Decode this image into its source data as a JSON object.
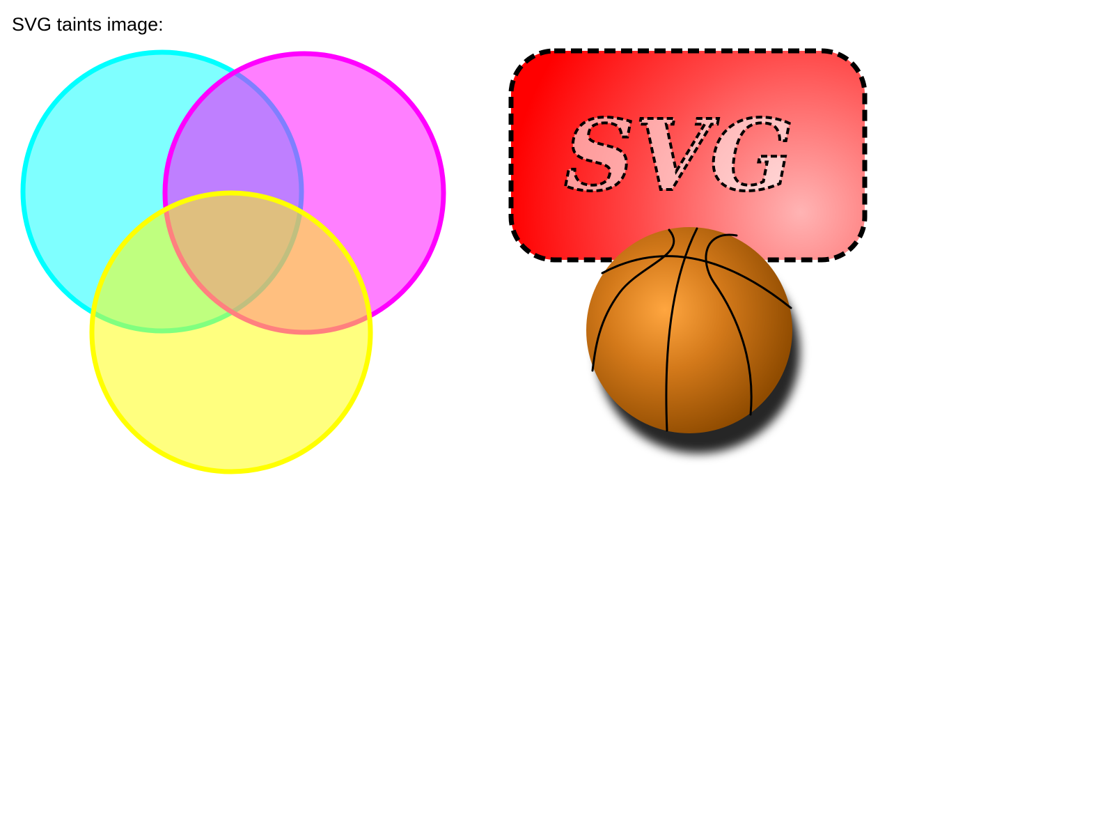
{
  "caption": "SVG taints image:",
  "venn": {
    "circles": [
      {
        "name": "cyan-circle",
        "stroke": "#00ffff",
        "fill": "#00ffff",
        "fill_opacity": 0.5
      },
      {
        "name": "magenta-circle",
        "stroke": "#ff00ff",
        "fill": "#ff00ff",
        "fill_opacity": 0.5
      },
      {
        "name": "yellow-circle",
        "stroke": "#ffff00",
        "fill": "#ffff00",
        "fill_opacity": 0.5
      }
    ]
  },
  "svg_badge": {
    "text": "SVG",
    "gradient_start": "#ff0000",
    "gradient_end": "#ffb0b0",
    "border_color": "#000000"
  },
  "basketball": {
    "highlight": "#ffa640",
    "base": "#d3791a",
    "shade": "#8f4b00",
    "seam_color": "#000000"
  }
}
